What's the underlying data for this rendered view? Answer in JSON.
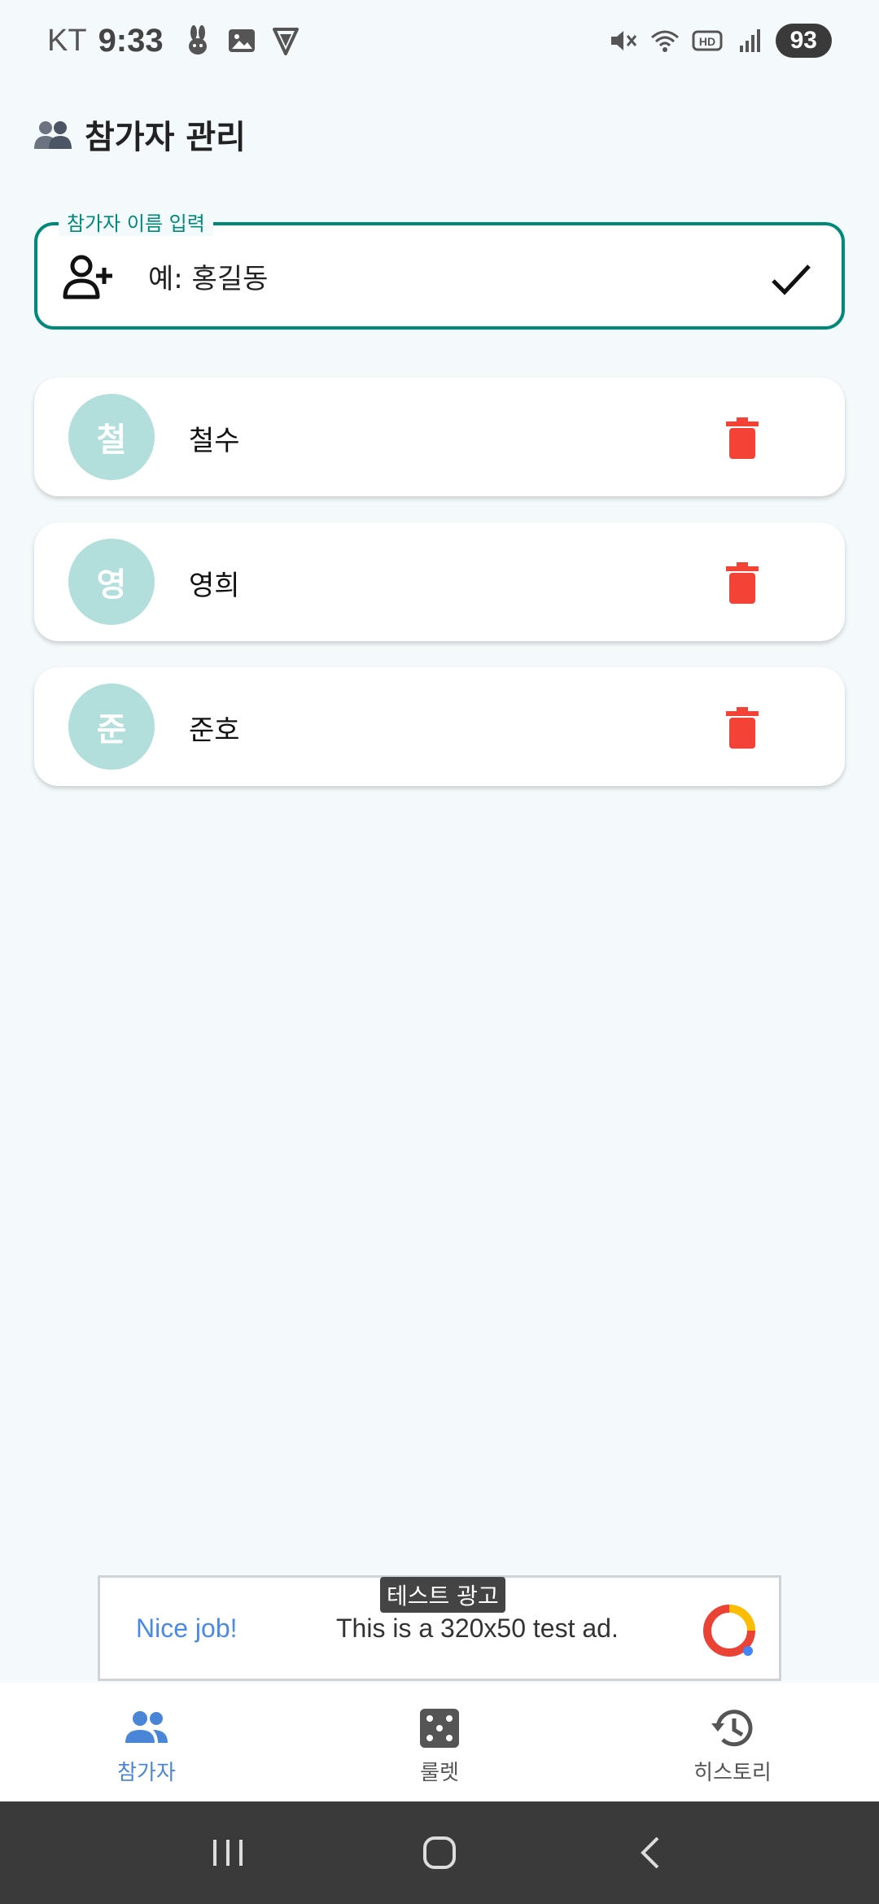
{
  "status_bar": {
    "carrier": "KT",
    "time": "9:33",
    "battery": "93"
  },
  "header": {
    "title": "참가자 관리",
    "icon": "group-icon"
  },
  "input": {
    "label": "참가자 이름 입력",
    "placeholder": "예: 홍길동",
    "value": ""
  },
  "participants": [
    {
      "initial": "철",
      "name": "철수"
    },
    {
      "initial": "영",
      "name": "영희"
    },
    {
      "initial": "준",
      "name": "준호"
    }
  ],
  "ad": {
    "badge": "테스트 광고",
    "headline": "Nice job!",
    "text": "This is a 320x50 test ad."
  },
  "bottom_nav": {
    "items": [
      {
        "label": "참가자",
        "icon": "people-icon",
        "active": true
      },
      {
        "label": "룰렛",
        "icon": "dice-icon",
        "active": false
      },
      {
        "label": "히스토리",
        "icon": "history-icon",
        "active": false
      }
    ]
  },
  "colors": {
    "accent": "#00897b",
    "avatar": "#b2dfdb",
    "delete": "#f44336",
    "nav_active": "#4a86d8",
    "background": "#f4fafb"
  }
}
